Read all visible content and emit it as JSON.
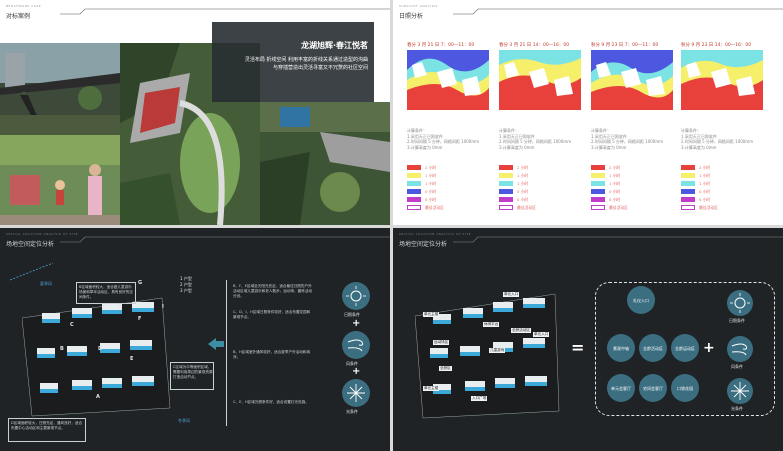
{
  "panel1": {
    "header": "对标案例",
    "title": "龙湖旭辉·春江悦茗",
    "description_line1": "灵活布局  折线空间  利用丰富的折线关系通过造型的沟曲",
    "description_line2": "与穿插营造出灵活寻富又不冗赘的社区空间"
  },
  "panel2": {
    "header": "日照分析",
    "seasons": [
      "春分 3 月 21 日 7：00—11：00",
      "春分 3 月 21 日 14：00—16：00",
      "秋分 9 月 23 日 7：00—11：00",
      "秋分 9 月 23 日 14：00—16：00"
    ],
    "calc_title": "计算条件：",
    "calc_lines": [
      "1.采用天正日照软件",
      "2.时间间隔 5 分钟，网格间距 1000mm",
      "3.计算高度为 0mm"
    ],
    "legend": [
      "2 小时",
      "1 小时",
      "1 小时",
      "0 小时",
      "0 小时"
    ],
    "legend_colors": [
      "#e8413c",
      "#f6ef6a",
      "#7be3e3",
      "#4d57e0",
      "#c13cc9"
    ],
    "legend_last": "最佳活动区"
  },
  "panel3": {
    "header": "场地空间定位分析",
    "label_north": "夏季风",
    "label_south": "冬季风",
    "legend": [
      "日照条件",
      "风条件",
      "光条件"
    ],
    "keys": [
      "1 户型",
      "2 户型",
      "3 户型"
    ],
    "blocks": [
      "A",
      "B",
      "C",
      "D",
      "E",
      "F",
      "G",
      "H",
      "I"
    ],
    "text_top": "B区域面积较大，适合做儿童游乐场景和草坪活动区，具有良好的空间条件。",
    "text_mid": "C区域为中等面积区域，需要利用周边的景观资源打造活动节点。",
    "text_bottom": "D区域面积较大，日照充足，通风良好，适合布置中心活动区和主要景观节点。",
    "notes": [
      "B、F、E区域全天阳光充足，适合最佳日照的户外活动区域儿童游乐和老人散步。运动场、晨练活动分设。",
      "C、D、I、H区域日照条件较好，适合布置花园和景观节点。",
      "B、H区域室外通风较好，适合夏季户外活动和纳凉。",
      "C、E、H区域光照条件好，适合设置灯光设施。"
    ],
    "cond_labels": [
      "日照条件",
      "风条件",
      "光条件"
    ]
  },
  "panel4": {
    "header": "场地空间定位分析",
    "buildings": [
      "单元入口",
      "单元主楼",
      "休闲平台",
      "全龄活动区",
      "运动场区",
      "单元入口",
      "儿童游戏",
      "全龄区",
      "单元主楼",
      "入口广场"
    ],
    "center_nodes": [
      "礼仪入口",
      "景观中轴",
      "全龄活动区",
      "全龄运动区",
      "单元会客厅",
      "宅间会客厅",
      "口袋花园"
    ],
    "cond_labels": [
      "日照条件",
      "风条件",
      "光条件"
    ],
    "equals": "=",
    "plus": "+"
  }
}
